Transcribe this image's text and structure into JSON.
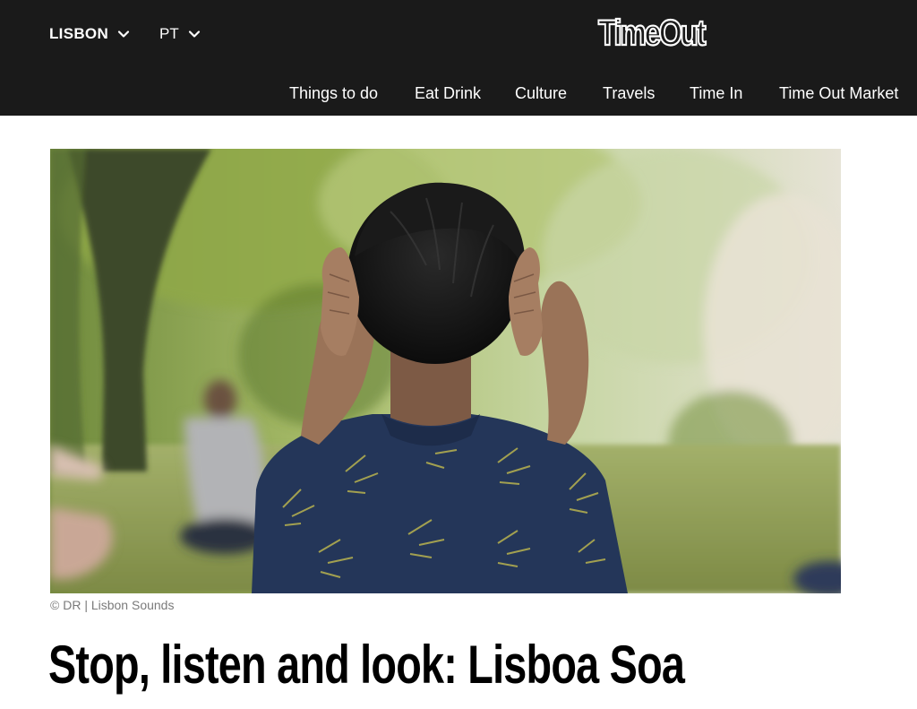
{
  "header": {
    "city_selector": {
      "label": "LISBON",
      "icon": "chevron-down-icon"
    },
    "language_selector": {
      "label": "PT",
      "icon": "chevron-down-icon"
    },
    "logo_text": "TimeOut",
    "background_color": "#1a1a1a",
    "text_color": "#ffffff"
  },
  "nav": {
    "items": [
      {
        "label": "Things to do"
      },
      {
        "label": "Eat Drink"
      },
      {
        "label": "Culture"
      },
      {
        "label": "Travels"
      },
      {
        "label": "Time In"
      },
      {
        "label": "Time Out Market"
      }
    ]
  },
  "article": {
    "hero_image_alt": "Person seen from behind covering their ears in a park, wearing a blue shirt with palm-leaf pattern",
    "image_caption": "© DR | Lisbon Sounds",
    "title": "Stop, listen and look: Lisboa Soa"
  }
}
